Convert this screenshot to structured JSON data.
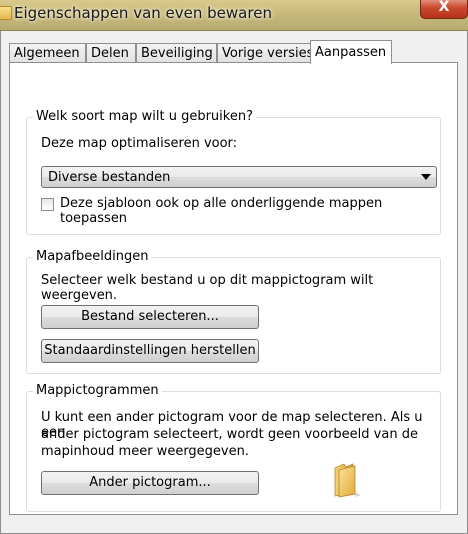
{
  "window": {
    "title": "Eigenschappen van even bewaren",
    "close_label": "X"
  },
  "tabs": [
    {
      "label": "Algemeen",
      "active": false
    },
    {
      "label": "Delen",
      "active": false
    },
    {
      "label": "Beveiliging",
      "active": false
    },
    {
      "label": "Vorige versies",
      "active": false
    },
    {
      "label": "Aanpassen",
      "active": true
    }
  ],
  "folder_type": {
    "title": "Welk soort map wilt u gebruiken?",
    "optimize_label": "Deze map optimaliseren voor:",
    "selected": "Diverse bestanden",
    "apply_template_label": "Deze sjabloon ook op alle onderliggende mappen toepassen",
    "apply_template_checked": false
  },
  "folder_pictures": {
    "title": "Mapafbeeldingen",
    "description": "Selecteer welk bestand u op dit mappictogram wilt weergeven.",
    "choose_file_label": "Bestand selecteren...",
    "restore_default_label": "Standaardinstellingen herstellen"
  },
  "folder_icons": {
    "title": "Mappictogrammen",
    "description_lines": [
      "U kunt een ander pictogram voor de map selecteren. Als u een",
      "ander pictogram selecteert, wordt geen voorbeeld van de",
      "mapinhoud meer weergegeven."
    ],
    "change_icon_label": "Ander pictogram..."
  },
  "colors": {
    "titlebar": "#c5b679",
    "close": "#c9472c",
    "folder": "#f0c650"
  },
  "icons": {
    "title": "folder-icon",
    "preview": "folder-icon"
  }
}
